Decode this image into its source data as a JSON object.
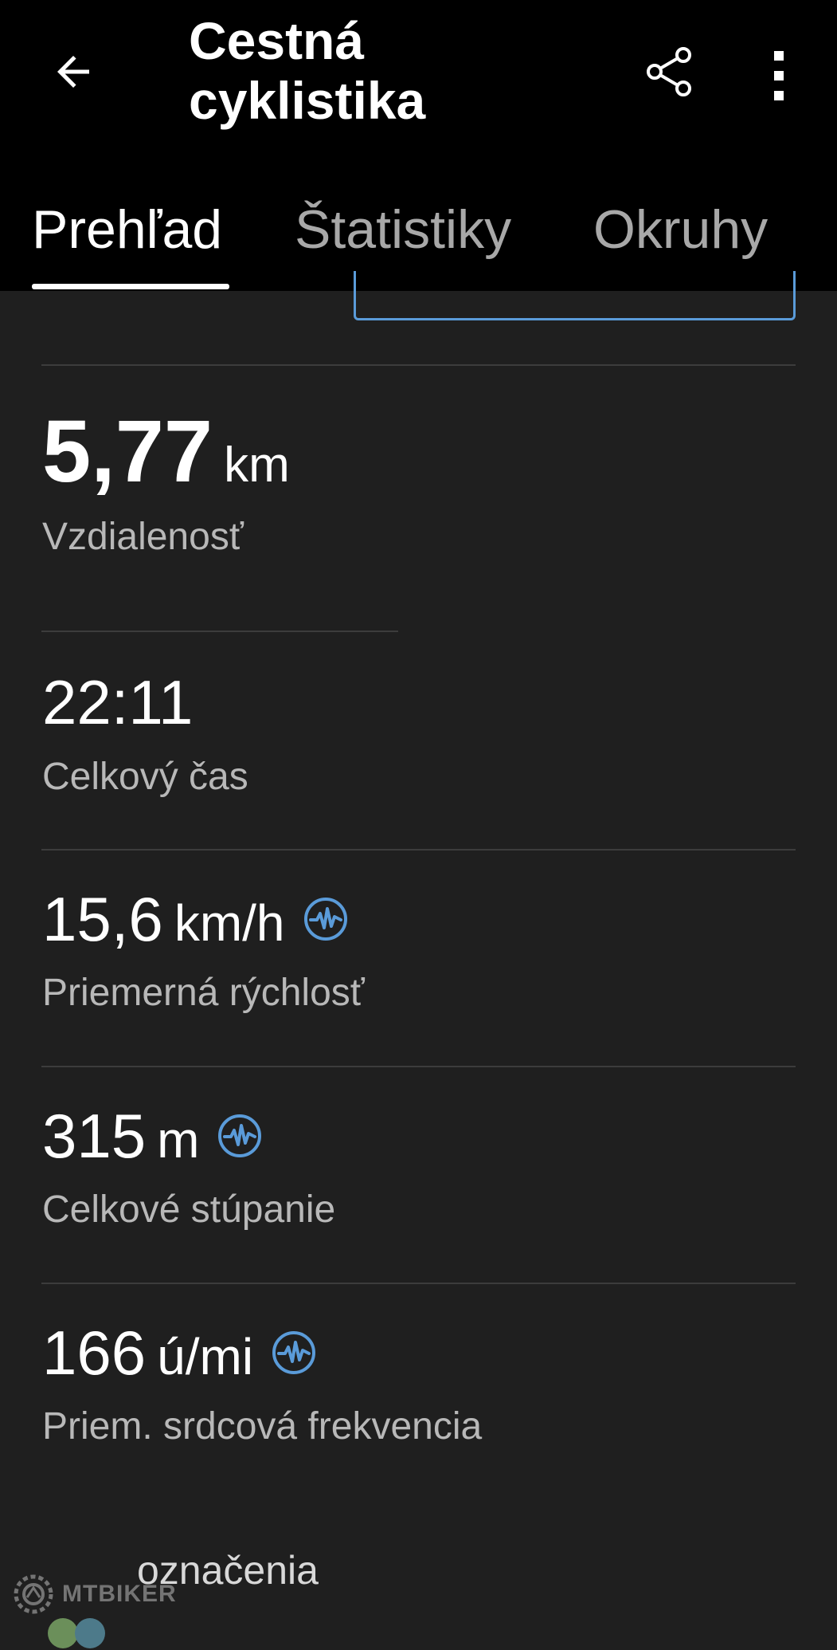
{
  "header": {
    "title": "Cestná\ncyklistika",
    "back_icon": "arrow-left-icon",
    "share_icon": "share-icon",
    "more_icon": "more-vertical-icon"
  },
  "tabs": [
    {
      "label": "Prehľad",
      "active": true
    },
    {
      "label": "Štatistiky",
      "active": false
    },
    {
      "label": "Okruhy",
      "active": false
    }
  ],
  "stats": [
    {
      "value": "5,77",
      "unit": "km",
      "label": "Vzdialenosť",
      "connect_icon": false
    },
    {
      "value": "22:11",
      "unit": "",
      "label": "Celkový čas",
      "connect_icon": false
    },
    {
      "value": "15,6",
      "unit": "km/h",
      "label": "Priemerná rýchlosť",
      "connect_icon": true
    },
    {
      "value": "315",
      "unit": "m",
      "label": "Celkové stúpanie",
      "connect_icon": true
    },
    {
      "value": "166",
      "unit": "ú/mi",
      "label": "Priem. srdcová frekvencia",
      "connect_icon": true
    }
  ],
  "footer": {
    "partial_text": "označenia"
  },
  "watermark": {
    "text": "MTBIKER"
  },
  "colors": {
    "background": "#1f1f1f",
    "appbar": "#000000",
    "accent": "#5a9bd9",
    "label": "#b8b8b8",
    "inactive_tab": "#a8a8a8",
    "divider": "#3c3c3c"
  }
}
